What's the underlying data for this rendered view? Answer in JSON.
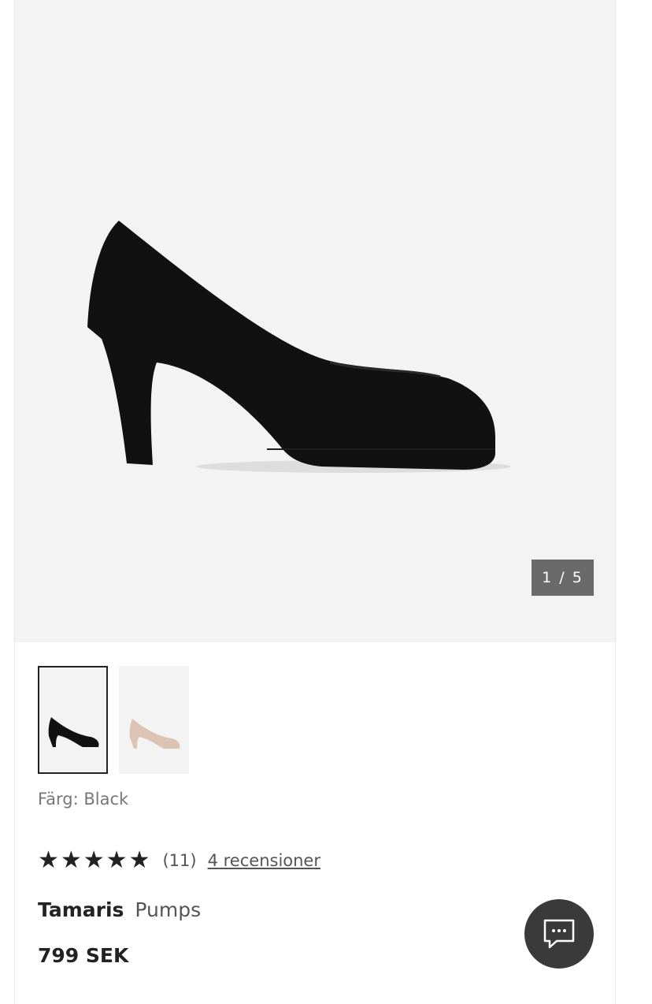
{
  "gallery": {
    "counter": "1 / 5"
  },
  "variants": [
    {
      "label": "Black",
      "selected": true
    },
    {
      "label": "Beige",
      "selected": false
    }
  ],
  "product": {
    "color_label": "Färg: Black",
    "stars": "★★★★★",
    "rating_value": 5,
    "rating_count": "(11)",
    "reviews_link": "4 recensioner",
    "brand": "Tamaris",
    "type": "Pumps",
    "price": "799 SEK"
  },
  "chat": {
    "icon": "chat-bubble-icon"
  },
  "colors": {
    "gallery_bg": "#f3f3f3",
    "counter_bg": "#6a6a6a",
    "chat_bg": "#3a3a3a",
    "text": "#222222"
  }
}
